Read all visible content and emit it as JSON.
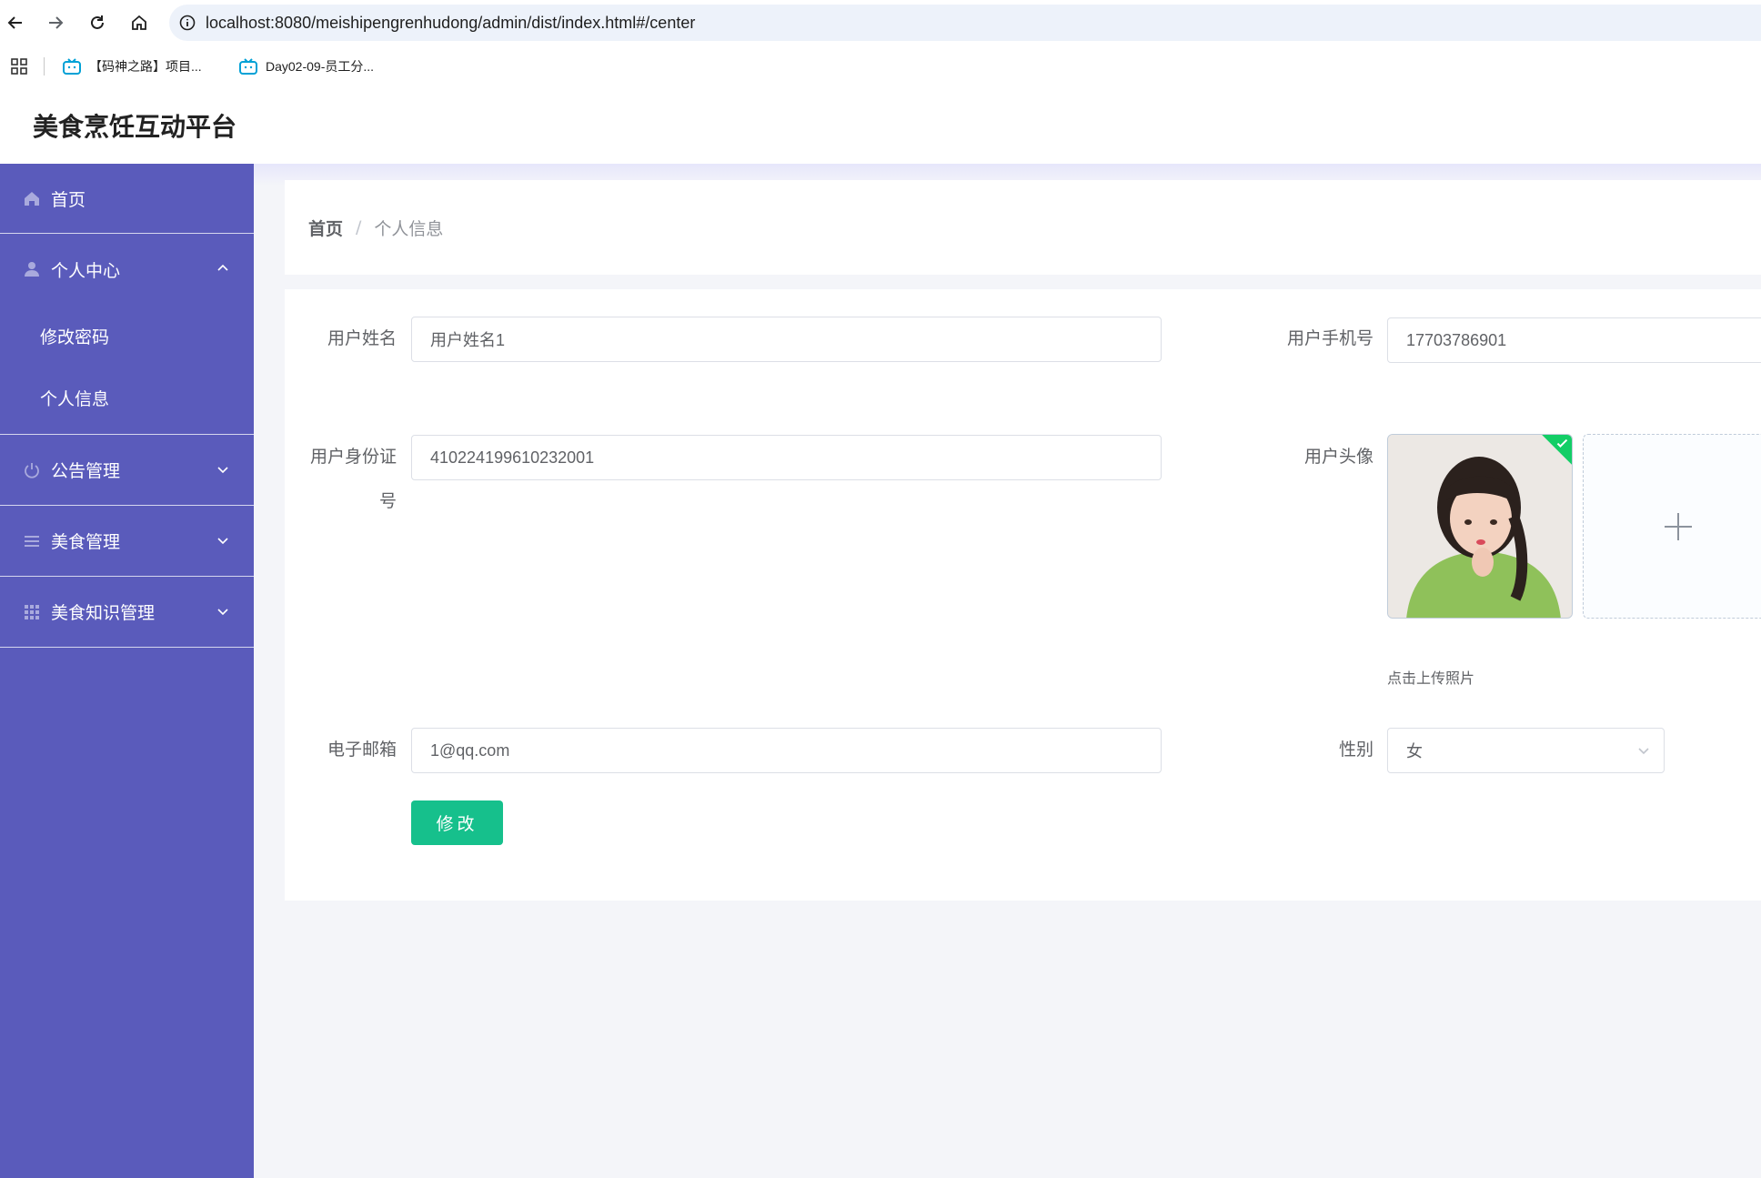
{
  "browser": {
    "url": "localhost:8080/meishipengrenhudong/admin/dist/index.html#/center",
    "bookmarks": [
      {
        "label": "【码神之路】项目..."
      },
      {
        "label": "Day02-09-员工分..."
      }
    ]
  },
  "app": {
    "title": "美食烹饪互动平台"
  },
  "sidebar": {
    "home": "首页",
    "personal_center": "个人中心",
    "sub_items": [
      "修改密码",
      "个人信息"
    ],
    "notice_mgmt": "公告管理",
    "food_mgmt": "美食管理",
    "food_knowledge_mgmt": "美食知识管理"
  },
  "breadcrumb": {
    "home": "首页",
    "separator": "/",
    "current": "个人信息"
  },
  "form": {
    "username_label": "用户姓名",
    "username_value": "用户姓名1",
    "phone_label": "用户手机号",
    "phone_value": "17703786901",
    "idcard_label": "用户身份证号",
    "idcard_value": "410224199610232001",
    "avatar_label": "用户头像",
    "upload_tip": "点击上传照片",
    "email_label": "电子邮箱",
    "email_value": "1@qq.com",
    "gender_label": "性别",
    "gender_value": "女",
    "submit_label": "修改"
  },
  "colors": {
    "sidebar_bg": "#5a5bbb",
    "submit_bg": "#16c08c",
    "success_badge": "#13ce66"
  }
}
